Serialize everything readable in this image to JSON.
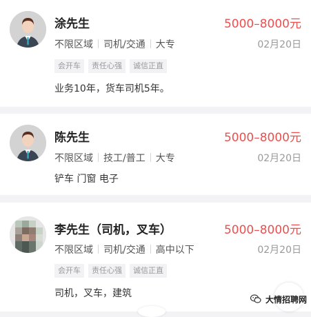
{
  "listings": [
    {
      "name": "涂先生",
      "salary": "5000–8000元",
      "location": "不限区域",
      "job": "司机/交通",
      "education": "大专",
      "date": "02月20日",
      "tags": [
        "会开车",
        "责任心强",
        "诚信正直"
      ],
      "description": "业务10年，货车司机5年。",
      "avatar": "default-male-avatar"
    },
    {
      "name": "陈先生",
      "salary": "5000–8000元",
      "location": "不限区域",
      "job": "技工/普工",
      "education": "大专",
      "date": "02月20日",
      "tags": [],
      "description": "铲车 门窗 电子",
      "avatar": "default-male-avatar"
    },
    {
      "name": "李先生（司机，叉车）",
      "salary": "5000–8000元",
      "location": "不限区域",
      "job": "司机/交通",
      "education": "高中以下",
      "date": "02月20日",
      "tags": [
        "会开车",
        "责任心强",
        "诚信正直"
      ],
      "description": "司机，叉车，建筑",
      "avatar": "photo-avatar"
    }
  ],
  "watermark": {
    "text": "大情招聘网",
    "icon": "wechat-icon"
  },
  "colors": {
    "salary": "#ee4e4e",
    "background": "#f3f3f6",
    "tag_bg": "#f2f2f5"
  }
}
